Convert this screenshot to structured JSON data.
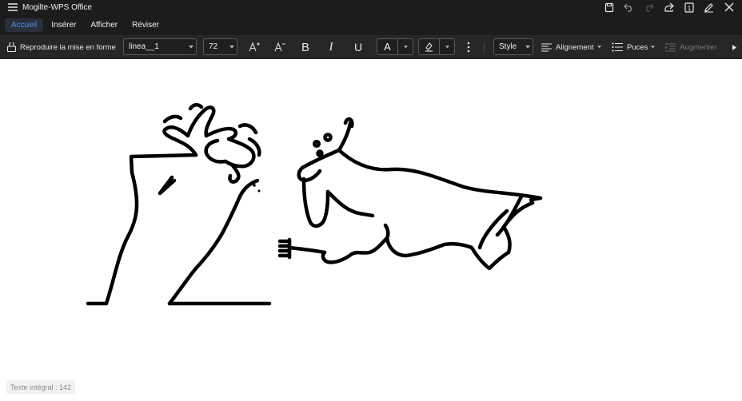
{
  "app": {
    "title": "Mogilte-WPS Office"
  },
  "tabs": [
    {
      "label": "Accueil",
      "active": true
    },
    {
      "label": "Insérer",
      "active": false
    },
    {
      "label": "Afficher",
      "active": false
    },
    {
      "label": "Réviser",
      "active": false
    }
  ],
  "toolbar": {
    "format_painter_label": "Reproduire la mise en forme",
    "font_name": "linea__1",
    "font_size": "72",
    "bold_glyph": "B",
    "italic_glyph": "I",
    "underline_glyph": "U",
    "font_color_glyph": "A",
    "style_label": "Style",
    "alignment_label": "Alignement",
    "bullets_label": "Puces",
    "increase_label": "Augmenter"
  },
  "status": {
    "word_count": "Texte intégral : 142"
  },
  "colors": {
    "accent": "#4d8ff5",
    "toolbar_bg": "#262626",
    "titlebar_bg": "#1c1c1c"
  },
  "icons": [
    "menu-icon",
    "save-icon",
    "undo-icon",
    "redo-icon",
    "share-icon",
    "page-count-icon",
    "edit-icon",
    "close-icon",
    "format-painter-icon",
    "increase-font-icon",
    "decrease-font-icon",
    "highlight-icon",
    "more-icon",
    "alignment-icon",
    "bullets-icon",
    "indent-icon",
    "chevron-right-icon"
  ]
}
